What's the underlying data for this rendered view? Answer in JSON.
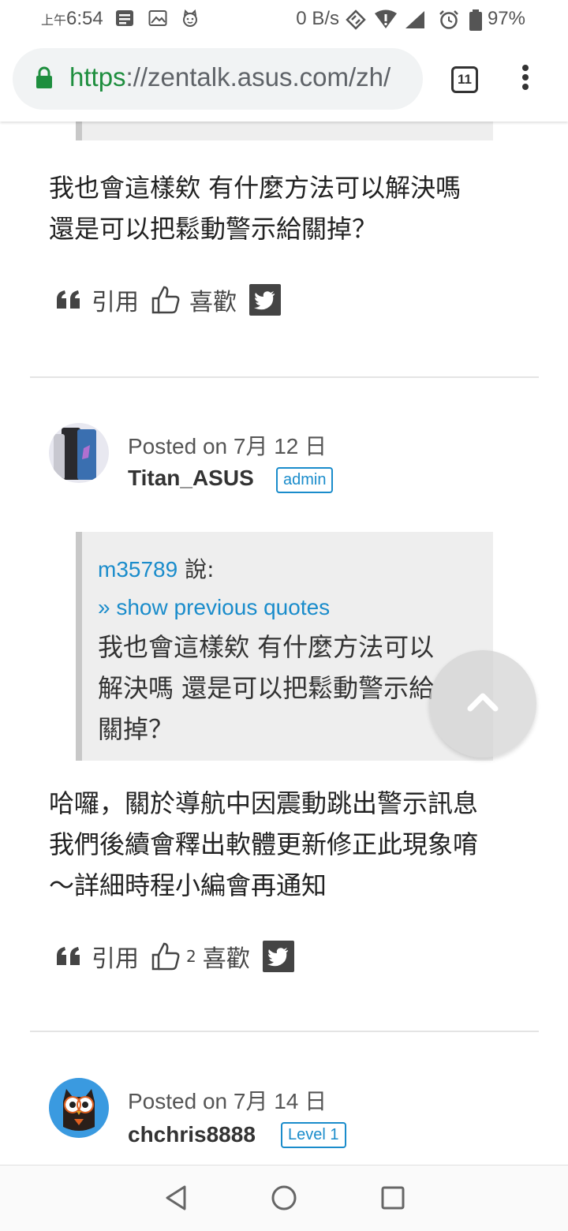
{
  "status_bar": {
    "ampm": "上午",
    "time": "6:54",
    "net_speed": "0 B/s",
    "battery": "97%"
  },
  "browser": {
    "url_scheme": "https",
    "url_rest": "://zentalk.asus.com/zh/",
    "tab_count": "11"
  },
  "post1": {
    "text_line1": "我也會這樣欸 有什麼方法可以解決嗎",
    "text_line2": "還是可以把鬆動警示給關掉？",
    "quote_label": "引用",
    "like_label": "喜歡"
  },
  "post2": {
    "posted": "Posted on 7月 12 日",
    "author": "Titan_ASUS",
    "badge": "admin",
    "quote": {
      "author": "m35789",
      "says": "說:",
      "show_more": "» show previous quotes",
      "line1": "我也會這樣欸 有什麼方法可以",
      "line2": "解決嗎  還是可以把鬆動警示給",
      "line3": "關掉？"
    },
    "text_line1": "哈囉，關於導航中因震動跳出警示訊息",
    "text_line2": "我們後續會釋出軟體更新修正此現象唷",
    "text_line3": "～詳細時程小編會再通知",
    "quote_label": "引用",
    "like_count": "2",
    "like_label": "喜歡"
  },
  "post3": {
    "posted": "Posted on 7月 14 日",
    "author": "chchris8888",
    "badge": "Level 1"
  },
  "colors": {
    "link": "#1a8ccb",
    "secure": "#1e8e3e",
    "quote_bg": "#eeeeee"
  },
  "icons": [
    "quote-icon",
    "thumbs-up-icon",
    "twitter-icon",
    "lock-icon",
    "chevron-up-icon",
    "back-icon",
    "home-icon",
    "recents-icon"
  ]
}
